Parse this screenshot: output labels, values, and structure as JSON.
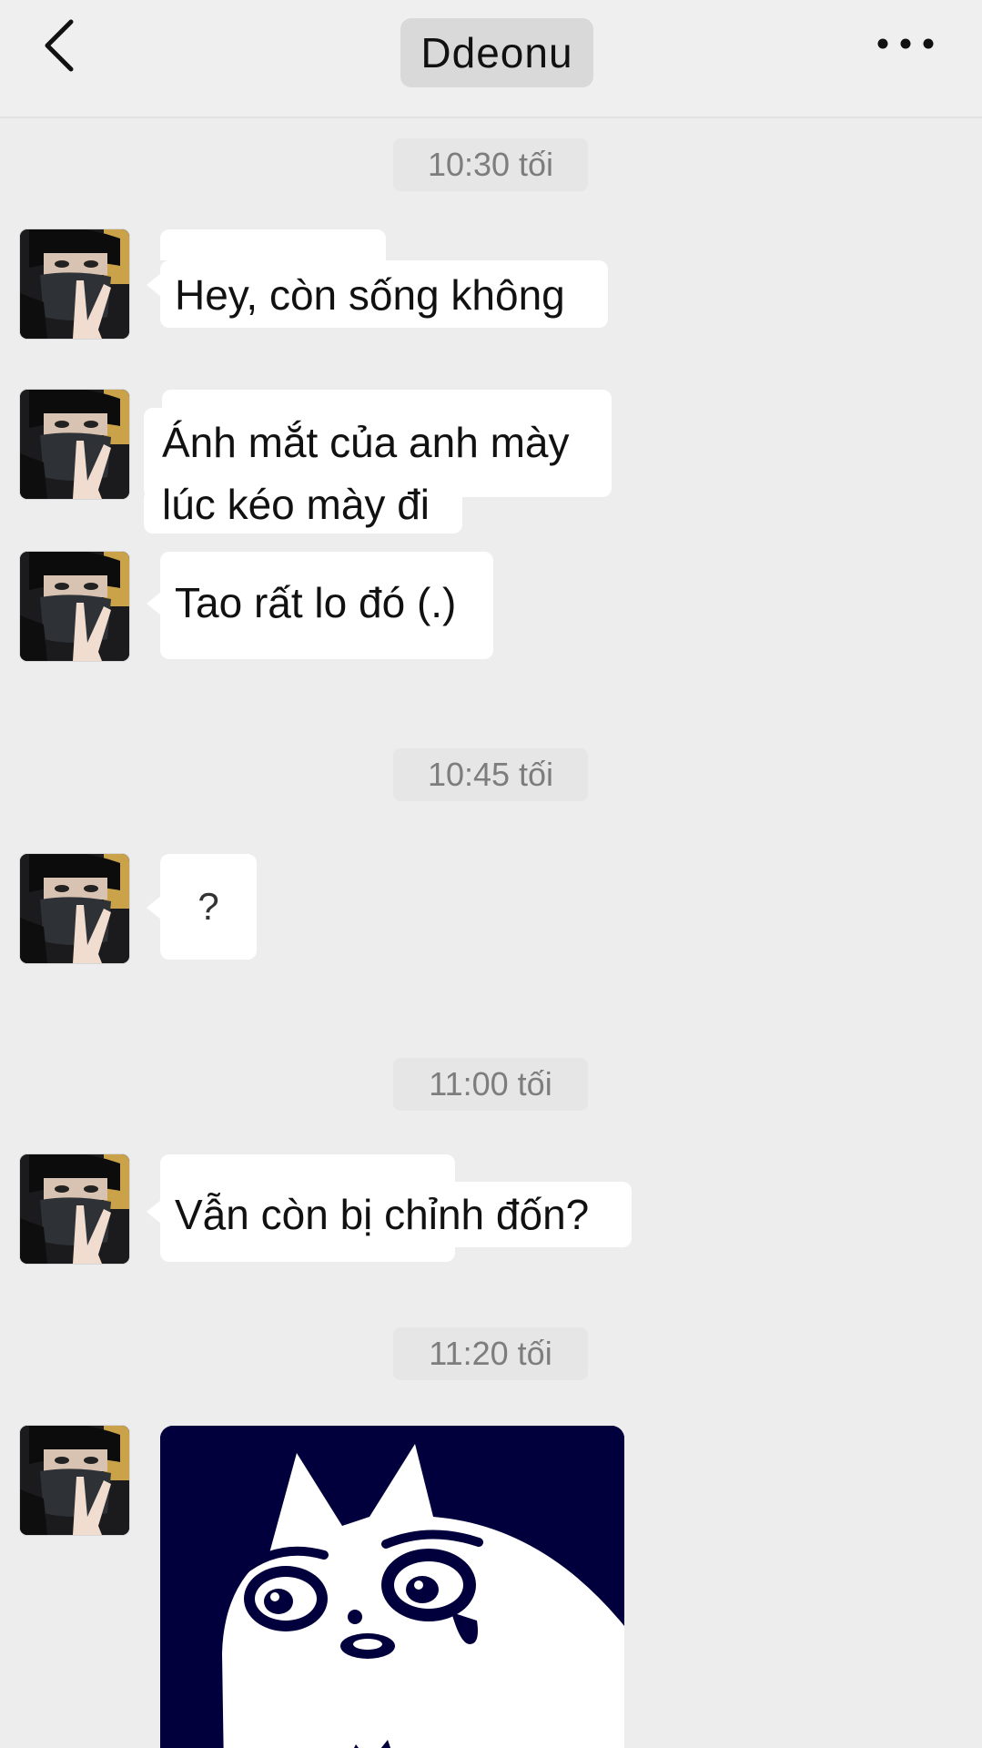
{
  "header": {
    "title": "Ddeonu",
    "back_icon": "chevron-left-icon",
    "more_icon": "more-horizontal-icon"
  },
  "messages": [
    {
      "time": "10:30 tối"
    },
    {
      "text": "Hey, còn sống không"
    },
    {
      "text_line1": "Ánh mắt của anh mày",
      "text_line2": "lúc kéo mày đi"
    },
    {
      "text": "Tao rất lo đó (.)"
    },
    {
      "time": "10:45 tối"
    },
    {
      "text": "?"
    },
    {
      "time": "11:00 tối"
    },
    {
      "text": "Vẫn còn bị chỉnh đốn?"
    },
    {
      "time": "11:20 tối"
    },
    {
      "sticker": "crying-cat-sticker"
    }
  ],
  "colors": {
    "background": "#ededed",
    "bubble": "#ffffff",
    "timestamp_text": "#7d7d7d",
    "sticker_background": "#02003c"
  }
}
